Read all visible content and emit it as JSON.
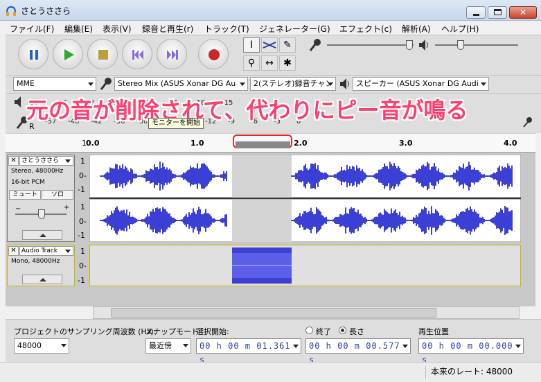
{
  "window": {
    "title": "さとうささら"
  },
  "menu": [
    {
      "label": "ファイル(F)"
    },
    {
      "label": "編集(E)"
    },
    {
      "label": "表示(V)"
    },
    {
      "label": "録音と再生(r)"
    },
    {
      "label": "トラック(T)"
    },
    {
      "label": "ジェネレーター(G)"
    },
    {
      "label": "エフェクト(c)"
    },
    {
      "label": "解析(A)"
    },
    {
      "label": "ヘルプ(H)"
    }
  ],
  "transport": [
    "pause-icon",
    "play-icon",
    "stop-icon",
    "skip-start-icon",
    "skip-end-icon",
    "record-icon"
  ],
  "devices": {
    "host": "MME",
    "input": "Stereo Mix (ASUS Xonar DG Au",
    "channels": "2(ステレオ)録音チャン",
    "output": "スピーカー (ASUS Xonar DG Audi"
  },
  "meter": {
    "play_scale": [
      "-57",
      "-48",
      "-42",
      "-36",
      "-30",
      "-24",
      "-18",
      "-15",
      "-12"
    ],
    "rec_scale": [
      "-57",
      "-48",
      "-42",
      "-36",
      "-30",
      "-24",
      "-18",
      "-12",
      "-9",
      "-6",
      "-3",
      "0"
    ],
    "rec_channel": "R",
    "tooltip": "モニターを開始"
  },
  "annotation": "元の音が削除されて、代わりにピー音が鳴る",
  "ruler": {
    "ticks": [
      "0.0",
      "1.0",
      "2.0",
      "3.0",
      "4.0"
    ],
    "left_mark": "1"
  },
  "tracks": [
    {
      "name": "さとうささら",
      "info1": "Stereo, 48000Hz",
      "info2": "16-bit PCM",
      "mute": "ミュート",
      "solo": "ソロ",
      "gain_minus": "−",
      "gain_plus": "+",
      "scale": [
        "1",
        "0-",
        "-1"
      ]
    },
    {
      "name": "Audio Track",
      "info1": "Mono, 48000Hz",
      "scale": [
        "1",
        "0-",
        "-1"
      ]
    }
  ],
  "selection": {
    "rate_label": "プロジェクトのサンプリング周波数 (Hz):",
    "rate_value": "48000",
    "snap_label": "スナップモード",
    "snap_value": "最近傍",
    "start_label": "選択開始:",
    "end_label": "終了",
    "length_label": "長さ",
    "pos_label": "再生位置",
    "start_value": "00 h 00 m 01.361 s",
    "length_value": "00 h 00 m 00.577 s",
    "pos_value": "00 h 00 m 00.000 s"
  },
  "status": {
    "rate": "本来のレート: 48000"
  },
  "colors": {
    "wave": "#3b3fd4",
    "annotation": "#ff3d6e",
    "selection": "#d4d4d4"
  }
}
